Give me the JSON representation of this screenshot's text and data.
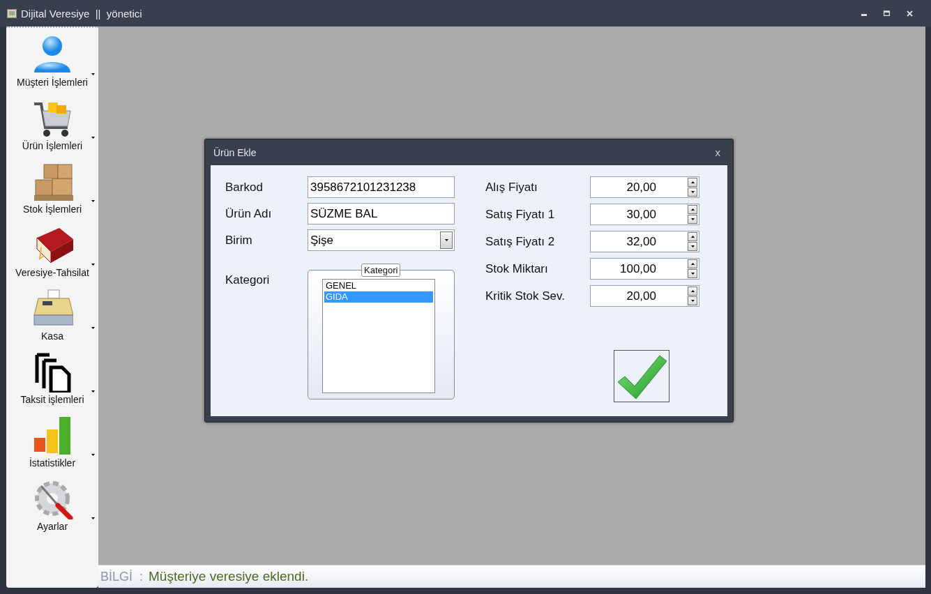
{
  "window": {
    "title": "Dijital Veresiye  ||  yönetici"
  },
  "sidebar": {
    "items": [
      {
        "label": "Müşteri İşlemleri",
        "kind": "user"
      },
      {
        "label": "Ürün İşlemleri",
        "kind": "cart"
      },
      {
        "label": "Stok İşlemleri",
        "kind": "boxes"
      },
      {
        "label": "Veresiye-Tahsilat",
        "kind": "book"
      },
      {
        "label": "Kasa",
        "kind": "register"
      },
      {
        "label": "Taksit işlemleri",
        "kind": "pages"
      },
      {
        "label": "İstatistikler",
        "kind": "bars"
      },
      {
        "label": "Ayarlar",
        "kind": "gear"
      }
    ]
  },
  "dialog": {
    "title": "Ürün Ekle",
    "close": "x",
    "fields": [
      {
        "label": "Barkod",
        "kind": "text",
        "value": "3958672101231238"
      },
      {
        "label": "Ürün Adı",
        "kind": "text",
        "value": "SÜZME BAL"
      },
      {
        "label": "Birim",
        "kind": "dropdown",
        "value": "Şişe"
      }
    ],
    "category": {
      "label": "Kategori",
      "group_title": "Kategori",
      "items": [
        {
          "label": "GENEL",
          "selected": false
        },
        {
          "label": "GIDA",
          "selected": true
        }
      ]
    },
    "numbers": [
      {
        "label": "Alış Fiyatı",
        "value": "20,00"
      },
      {
        "label": "Satış Fiyatı 1",
        "value": "30,00"
      },
      {
        "label": "Satış Fiyatı 2",
        "value": "32,00"
      },
      {
        "label": "Stok Miktarı",
        "value": "100,00"
      },
      {
        "label": "Kritik Stok Sev.",
        "value": "20,00"
      }
    ]
  },
  "status_bar": {
    "label": "BİLGİ  :",
    "message": "Müşteriye veresiye eklendi."
  }
}
